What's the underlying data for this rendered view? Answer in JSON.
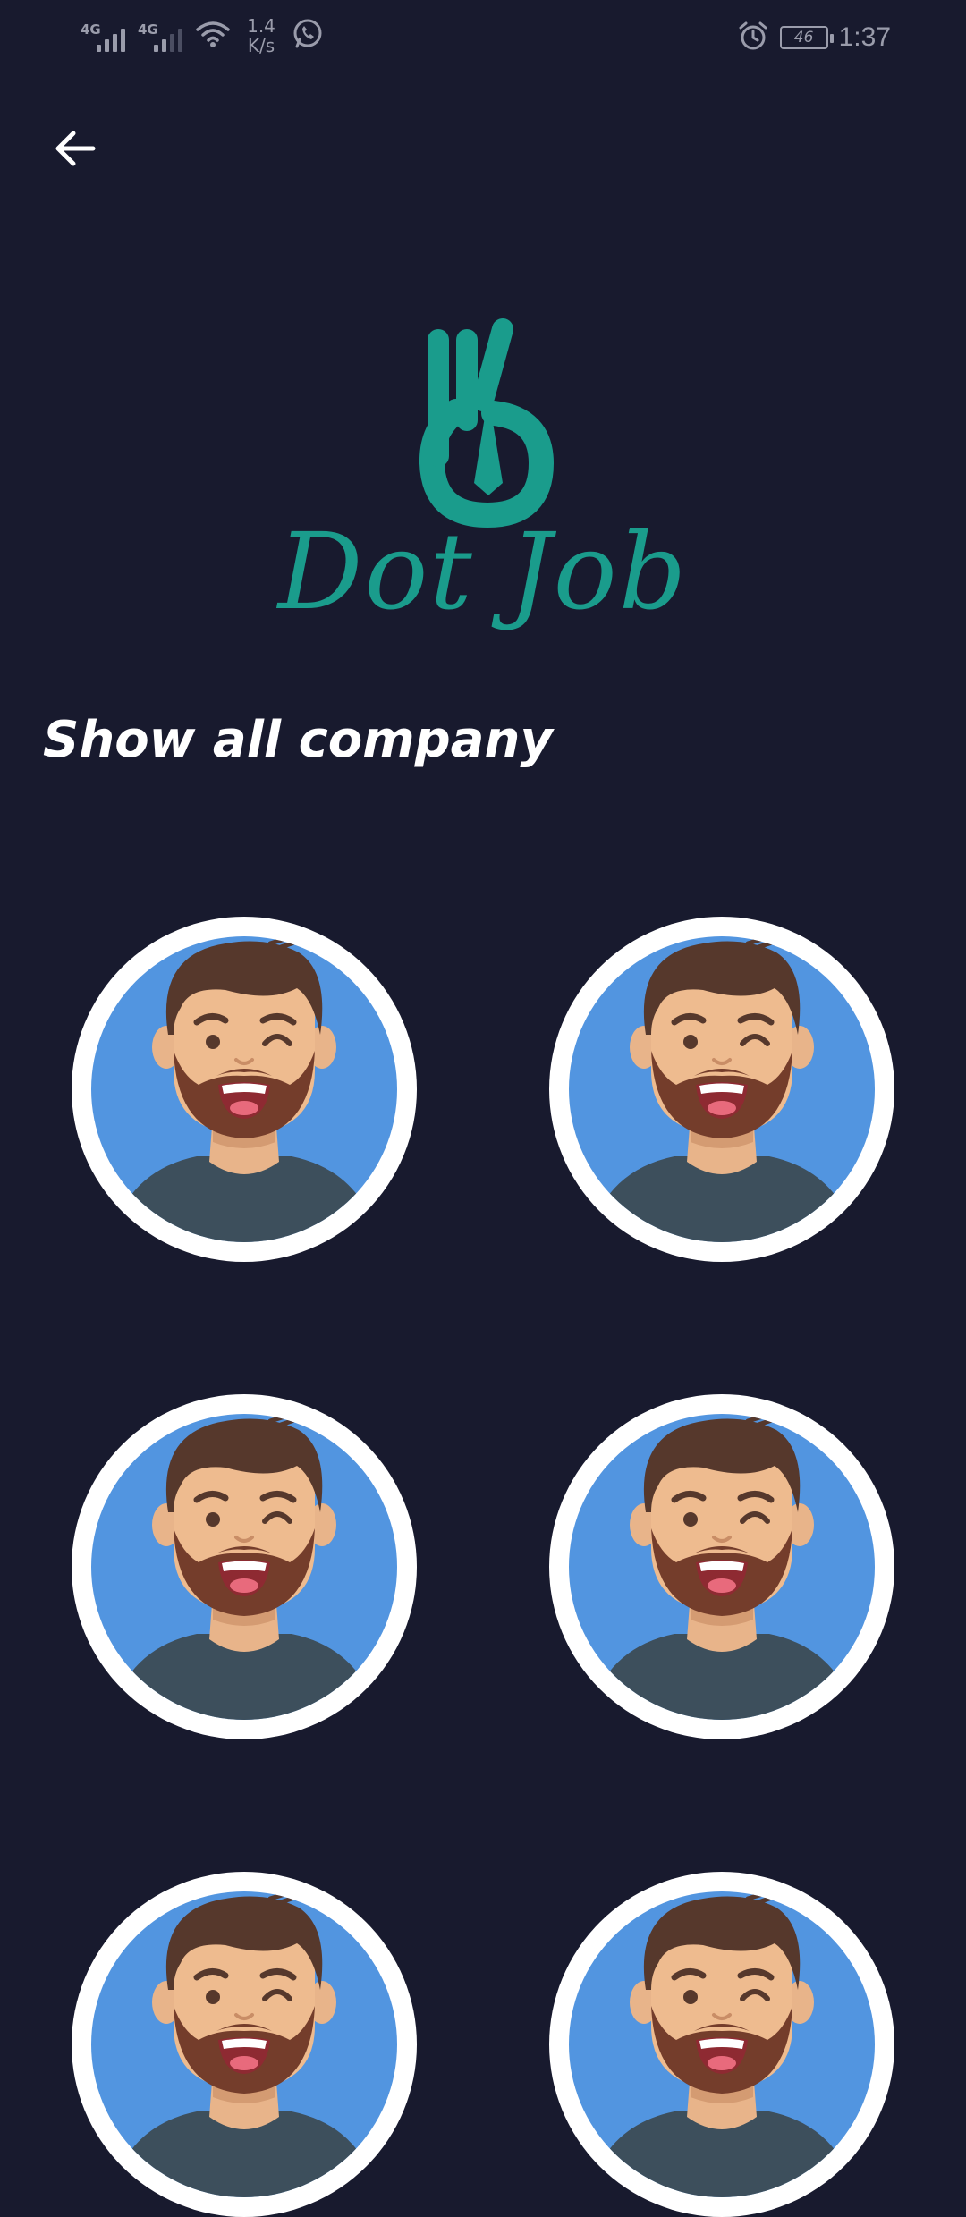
{
  "status_bar": {
    "network_1": "4G",
    "network_2": "4G",
    "speed_value": "1.4",
    "speed_unit": "K/s",
    "battery": "46",
    "time": "1:37"
  },
  "header": {
    "back_icon": "arrow-left-icon"
  },
  "logo": {
    "text": "Dot Job",
    "color": "#1a9c8c"
  },
  "section": {
    "title": "Show all company"
  },
  "companies": [
    {
      "avatar": "man-avatar"
    },
    {
      "avatar": "man-avatar"
    },
    {
      "avatar": "man-avatar"
    },
    {
      "avatar": "man-avatar"
    },
    {
      "avatar": "man-avatar"
    },
    {
      "avatar": "man-avatar"
    }
  ],
  "colors": {
    "background": "#181a2e",
    "accent": "#1a9c8c",
    "avatar_bg": "#5295e0"
  }
}
